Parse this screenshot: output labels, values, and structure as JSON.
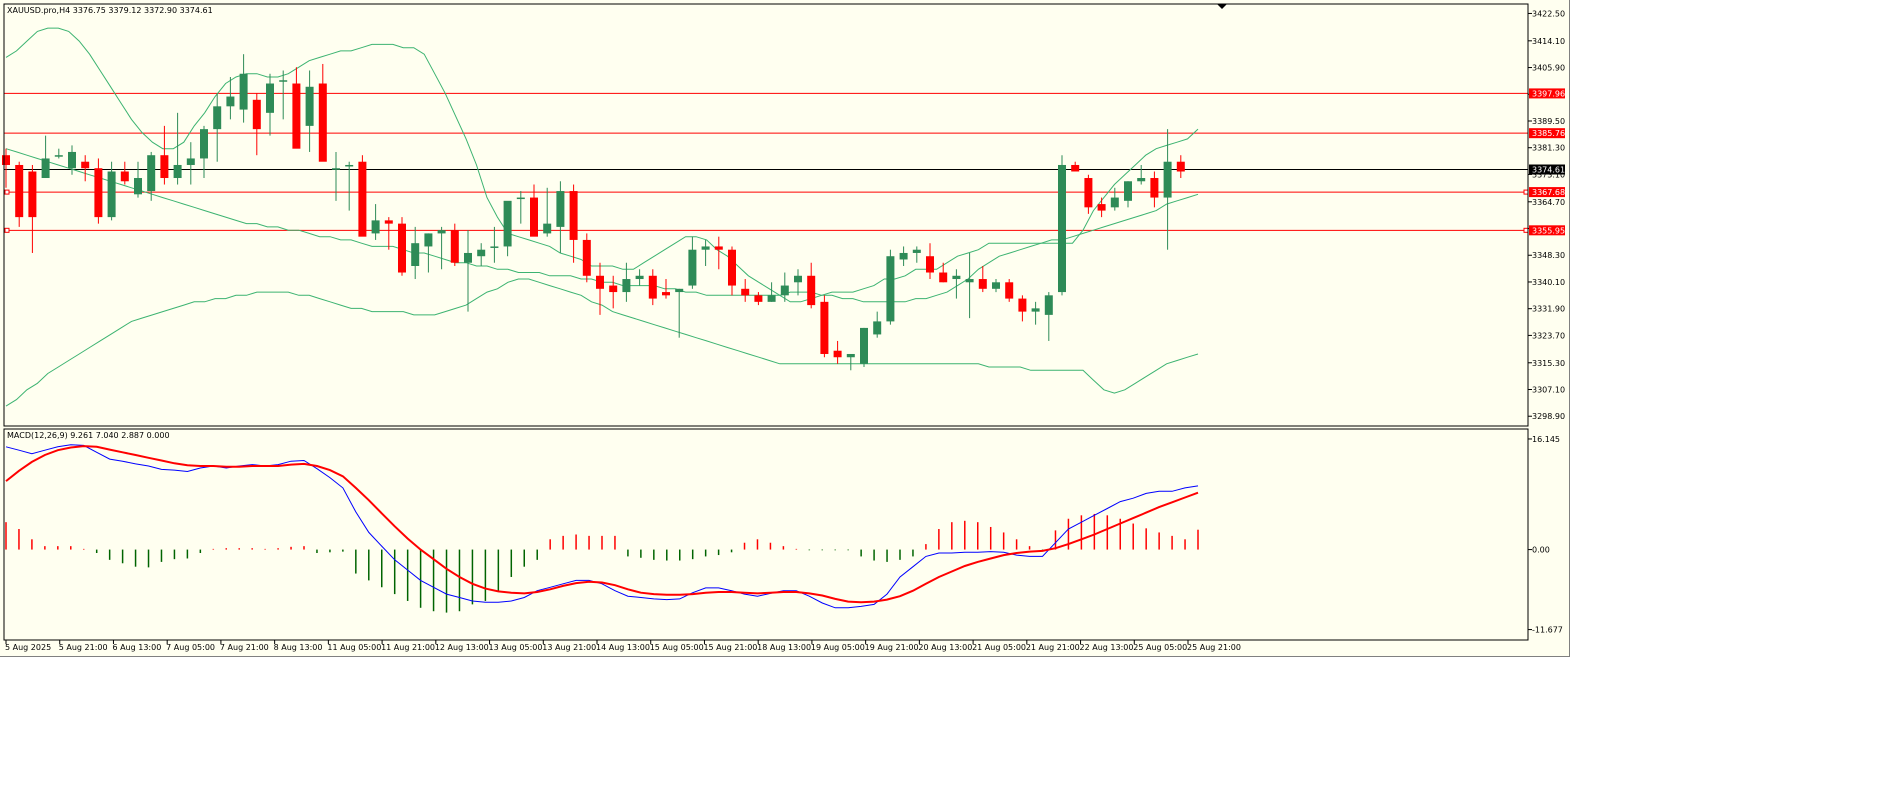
{
  "header": {
    "info": "XAUUSD.pro,H4  3376.75 3379.12 3372.90 3374.61"
  },
  "macd_panel": {
    "info": "MACD(12,26,9) 9.261 7.040 2.887 0.000"
  },
  "colors": {
    "background": "#fffff0",
    "bull": "#2e8b57",
    "bear": "#ff0000",
    "bollinger": "#3cb371",
    "hline": "#ff0000",
    "macd_line": "#0000ff",
    "signal_line": "#ff0000"
  },
  "chart_data": [
    {
      "type": "candlestick",
      "symbol": "XAUUSD.pro",
      "timeframe": "H4",
      "ohlc_header": {
        "open": 3376.75,
        "high": 3379.12,
        "low": 3372.9,
        "close": 3374.61
      },
      "ylim": [
        3295.9,
        3425.4
      ],
      "y_ticks": [
        3422.5,
        3414.1,
        3405.9,
        3397.7,
        3389.5,
        3381.3,
        3373.1,
        3364.7,
        3356.5,
        3348.3,
        3340.1,
        3331.9,
        3323.7,
        3315.3,
        3307.1,
        3298.9
      ],
      "price_levels": [
        {
          "label": "3397.96",
          "value": 3397.96
        },
        {
          "label": "3385.76",
          "value": 3385.76
        },
        {
          "label": "3367.68",
          "value": 3367.68
        },
        {
          "label": "3355.95",
          "value": 3355.95
        }
      ],
      "current_price": {
        "label": "3374.61",
        "value": 3374.61
      },
      "x_labels": [
        "5 Aug 2025",
        "5 Aug 21:00",
        "6 Aug 13:00",
        "7 Aug 05:00",
        "7 Aug 21:00",
        "8 Aug 13:00",
        "11 Aug 05:00",
        "11 Aug 21:00",
        "12 Aug 13:00",
        "13 Aug 05:00",
        "13 Aug 21:00",
        "14 Aug 13:00",
        "15 Aug 05:00",
        "15 Aug 21:00",
        "18 Aug 13:00",
        "19 Aug 05:00",
        "19 Aug 21:00",
        "20 Aug 13:00",
        "21 Aug 05:00",
        "21 Aug 21:00",
        "22 Aug 13:00",
        "25 Aug 05:00",
        "25 Aug 21:00"
      ],
      "candles": [
        [
          3379,
          3381,
          3369,
          3376
        ],
        [
          3376,
          3377,
          3357,
          3360
        ],
        [
          3374,
          3376,
          3349,
          3360
        ],
        [
          3372,
          3385,
          3372,
          3378
        ],
        [
          3379,
          3381,
          3378,
          3379
        ],
        [
          3375,
          3382,
          3373,
          3380
        ],
        [
          3377,
          3379,
          3371,
          3375
        ],
        [
          3375,
          3378,
          3358,
          3360
        ],
        [
          3360,
          3377,
          3359,
          3374
        ],
        [
          3374,
          3377,
          3370,
          3371
        ],
        [
          3367,
          3377,
          3366,
          3372
        ],
        [
          3368,
          3380,
          3365,
          3379
        ],
        [
          3379,
          3388,
          3370,
          3372
        ],
        [
          3372,
          3392,
          3370,
          3376
        ],
        [
          3376,
          3383,
          3370,
          3378
        ],
        [
          3378,
          3388,
          3372,
          3387
        ],
        [
          3387,
          3398,
          3377,
          3394
        ],
        [
          3394,
          3403,
          3390,
          3397
        ],
        [
          3393,
          3410,
          3389,
          3404
        ],
        [
          3396,
          3398,
          3379,
          3387
        ],
        [
          3392,
          3404,
          3385,
          3401
        ],
        [
          3402,
          3405,
          3390,
          3402
        ],
        [
          3401,
          3406,
          3386,
          3381
        ],
        [
          3388,
          3405,
          3380,
          3400
        ],
        [
          3401,
          3407,
          3385,
          3377
        ],
        [
          3375,
          3380,
          3365,
          3375
        ],
        [
          3376,
          3377,
          3362,
          3376
        ],
        [
          3377,
          3379,
          3358,
          3354
        ],
        [
          3355,
          3364,
          3353,
          3359
        ],
        [
          3359,
          3360,
          3350,
          3358
        ],
        [
          3358,
          3360,
          3342,
          3343
        ],
        [
          3345,
          3357,
          3341,
          3352
        ],
        [
          3351,
          3355,
          3343,
          3355
        ],
        [
          3355,
          3357,
          3344,
          3356
        ],
        [
          3356,
          3358,
          3345,
          3346
        ],
        [
          3346,
          3356,
          3331,
          3349
        ],
        [
          3348,
          3352,
          3345,
          3350
        ],
        [
          3351,
          3357,
          3346,
          3351
        ],
        [
          3351,
          3363,
          3348,
          3365
        ],
        [
          3366,
          3368,
          3358,
          3366
        ],
        [
          3366,
          3370,
          3356,
          3354
        ],
        [
          3355,
          3369,
          3354,
          3358
        ],
        [
          3357,
          3371,
          3349,
          3368
        ],
        [
          3368,
          3370,
          3346,
          3353
        ],
        [
          3353,
          3355,
          3340,
          3342
        ],
        [
          3342,
          3346,
          3330,
          3338
        ],
        [
          3339,
          3342,
          3332,
          3337
        ],
        [
          3337,
          3346,
          3334,
          3341
        ],
        [
          3341,
          3344,
          3339,
          3342
        ],
        [
          3342,
          3344,
          3333,
          3335
        ],
        [
          3337,
          3341,
          3335,
          3336
        ],
        [
          3337,
          3338,
          3323,
          3338
        ],
        [
          3339,
          3354,
          3338,
          3350
        ],
        [
          3350,
          3353,
          3345,
          3351
        ],
        [
          3351,
          3354,
          3344,
          3350
        ],
        [
          3350,
          3351,
          3336,
          3339
        ],
        [
          3338,
          3341,
          3334,
          3336
        ],
        [
          3336,
          3337,
          3333,
          3334
        ],
        [
          3334,
          3340,
          3334,
          3336
        ],
        [
          3336,
          3343,
          3334,
          3339
        ],
        [
          3340,
          3344,
          3336,
          3342
        ],
        [
          3342,
          3346,
          3332,
          3333
        ],
        [
          3334,
          3336,
          3317,
          3318
        ],
        [
          3319,
          3322,
          3315,
          3317
        ],
        [
          3317,
          3318,
          3313,
          3318
        ],
        [
          3315,
          3326,
          3314,
          3326
        ],
        [
          3324,
          3331,
          3323,
          3328
        ],
        [
          3328,
          3350,
          3327,
          3348
        ],
        [
          3347,
          3351,
          3345,
          3349
        ],
        [
          3349,
          3351,
          3346,
          3350
        ],
        [
          3348,
          3352,
          3341,
          3343
        ],
        [
          3343,
          3346,
          3340,
          3340
        ],
        [
          3341,
          3344,
          3335,
          3342
        ],
        [
          3340,
          3349,
          3329,
          3341
        ],
        [
          3341,
          3345,
          3337,
          3338
        ],
        [
          3338,
          3341,
          3337,
          3340
        ],
        [
          3340,
          3341,
          3334,
          3335
        ],
        [
          3335,
          3336,
          3328,
          3331
        ],
        [
          3331,
          3334,
          3327,
          3332
        ],
        [
          3330,
          3337,
          3322,
          3336
        ],
        [
          3337,
          3379,
          3336,
          3376
        ],
        [
          3376,
          3377,
          3374,
          3374
        ],
        [
          3372,
          3373,
          3361,
          3363
        ],
        [
          3364,
          3366,
          3360,
          3362
        ],
        [
          3363,
          3369,
          3362,
          3366
        ],
        [
          3365,
          3371,
          3363,
          3371
        ],
        [
          3371,
          3376,
          3370,
          3372
        ],
        [
          3372,
          3374,
          3363,
          3366
        ],
        [
          3366,
          3387,
          3350,
          3377
        ],
        [
          3377,
          3379,
          3372,
          3374
        ]
      ],
      "bollinger": {
        "upper": [
          3409,
          3411,
          3414,
          3417,
          3418,
          3418,
          3417,
          3414,
          3410,
          3405,
          3400,
          3395,
          3390,
          3386,
          3383,
          3381,
          3381,
          3383,
          3388,
          3392,
          3397,
          3401,
          3403,
          3404,
          3404,
          3403,
          3403,
          3404,
          3406,
          3408,
          3409,
          3410,
          3411,
          3411,
          3412,
          3413,
          3413,
          3413,
          3412,
          3412,
          3410,
          3404,
          3398,
          3391,
          3384,
          3376,
          3366,
          3360,
          3355,
          3354,
          3353,
          3352,
          3351,
          3349,
          3348,
          3347,
          3345,
          3345,
          3345,
          3344,
          3344,
          3346,
          3348,
          3350,
          3352,
          3354,
          3354,
          3353,
          3350,
          3348,
          3345,
          3342,
          3340,
          3338,
          3336,
          3334,
          3334,
          3335,
          3336,
          3337,
          3337,
          3337,
          3338,
          3339,
          3341,
          3341,
          3342,
          3344,
          3344,
          3344,
          3346,
          3348,
          3349,
          3350,
          3352,
          3352,
          3352,
          3352,
          3352,
          3352,
          3352,
          3352,
          3352,
          3356,
          3362,
          3366,
          3370,
          3373,
          3376,
          3379,
          3381,
          3382,
          3383,
          3384,
          3387
        ],
        "middle": [
          3381,
          3380,
          3379,
          3378,
          3377,
          3376,
          3375,
          3374,
          3373,
          3372,
          3371,
          3370,
          3369,
          3368,
          3367,
          3366,
          3365,
          3364,
          3363,
          3362,
          3361,
          3360,
          3359,
          3358,
          3358,
          3357,
          3357,
          3356,
          3356,
          3355,
          3354,
          3354,
          3353,
          3353,
          3352,
          3351,
          3351,
          3351,
          3350,
          3349,
          3349,
          3348,
          3347,
          3346,
          3346,
          3345,
          3345,
          3344,
          3344,
          3343,
          3343,
          3343,
          3342,
          3342,
          3342,
          3341,
          3341,
          3340,
          3340,
          3339,
          3339,
          3339,
          3339,
          3338,
          3338,
          3337,
          3337,
          3336,
          3336,
          3336,
          3336,
          3336,
          3336,
          3336,
          3336,
          3337,
          3337,
          3337,
          3336,
          3336,
          3335,
          3335,
          3334,
          3334,
          3334,
          3334,
          3334,
          3335,
          3335,
          3336,
          3337,
          3339,
          3341,
          3344,
          3346,
          3348,
          3349,
          3350,
          3351,
          3352,
          3353,
          3353,
          3354,
          3355,
          3356,
          3357,
          3358,
          3359,
          3360,
          3361,
          3362,
          3364,
          3365,
          3366,
          3367
        ],
        "lower": [
          3302,
          3304,
          3307,
          3309,
          3312,
          3314,
          3316,
          3318,
          3320,
          3322,
          3324,
          3326,
          3328,
          3329,
          3330,
          3331,
          3332,
          3333,
          3334,
          3334,
          3335,
          3335,
          3336,
          3336,
          3337,
          3337,
          3337,
          3337,
          3336,
          3336,
          3335,
          3334,
          3333,
          3332,
          3332,
          3331,
          3331,
          3331,
          3331,
          3330,
          3330,
          3330,
          3331,
          3332,
          3333,
          3335,
          3337,
          3338,
          3340,
          3341,
          3341,
          3340,
          3339,
          3338,
          3337,
          3336,
          3334,
          3333,
          3331,
          3330,
          3329,
          3328,
          3327,
          3326,
          3325,
          3324,
          3323,
          3322,
          3321,
          3320,
          3319,
          3318,
          3317,
          3316,
          3315,
          3315,
          3315,
          3315,
          3315,
          3315,
          3315,
          3315,
          3315,
          3315,
          3315,
          3315,
          3315,
          3315,
          3315,
          3315,
          3315,
          3315,
          3315,
          3315,
          3314,
          3314,
          3314,
          3314,
          3313,
          3313,
          3313,
          3313,
          3313,
          3313,
          3310,
          3307,
          3306,
          3307,
          3309,
          3311,
          3313,
          3315,
          3316,
          3317,
          3318
        ]
      }
    },
    {
      "type": "macd",
      "label": "MACD(12,26,9) 9.261 7.040 2.887 0.000",
      "ylim": [
        -13.2,
        17.6
      ],
      "y_ticks": [
        16.145,
        0.0,
        -11.677
      ],
      "macd": [
        15.0,
        14.5,
        14.0,
        14.5,
        15.0,
        15.3,
        15.2,
        14.2,
        13.2,
        12.9,
        12.5,
        12.2,
        11.7,
        11.6,
        11.4,
        11.9,
        12.2,
        11.9,
        12.2,
        12.4,
        12.2,
        12.4,
        12.9,
        13.0,
        11.8,
        10.5,
        9.0,
        5.5,
        2.5,
        0.5,
        -1.5,
        -3.0,
        -4.5,
        -5.5,
        -6.5,
        -7.0,
        -7.5,
        -7.7,
        -7.7,
        -7.5,
        -7.0,
        -6.0,
        -5.5,
        -5.0,
        -4.5,
        -4.5,
        -5.0,
        -6.0,
        -6.8,
        -7.0,
        -7.2,
        -7.3,
        -7.2,
        -6.3,
        -5.6,
        -5.6,
        -6.0,
        -6.5,
        -6.8,
        -6.4,
        -6.0,
        -6.0,
        -6.8,
        -7.8,
        -8.5,
        -8.5,
        -8.3,
        -8.0,
        -6.5,
        -4.0,
        -2.5,
        -1.0,
        -0.5,
        -0.5,
        -0.4,
        -0.4,
        -0.3,
        -0.4,
        -0.8,
        -1.0,
        -1.0,
        1.0,
        3.0,
        4.0,
        5.0,
        6.0,
        7.0,
        7.5,
        8.2,
        8.5,
        8.5,
        9.0,
        9.3
      ],
      "signal": [
        10.0,
        11.5,
        12.8,
        13.8,
        14.5,
        14.9,
        15.1,
        15.0,
        14.6,
        14.2,
        13.8,
        13.4,
        13.0,
        12.6,
        12.3,
        12.2,
        12.2,
        12.1,
        12.1,
        12.2,
        12.2,
        12.2,
        12.4,
        12.5,
        12.2,
        11.6,
        10.7,
        9.0,
        7.2,
        5.3,
        3.4,
        1.6,
        0.0,
        -1.4,
        -2.8,
        -4.0,
        -5.0,
        -5.7,
        -6.1,
        -6.3,
        -6.4,
        -6.2,
        -5.8,
        -5.3,
        -4.9,
        -4.7,
        -4.8,
        -5.2,
        -5.8,
        -6.3,
        -6.5,
        -6.6,
        -6.6,
        -6.5,
        -6.3,
        -6.2,
        -6.2,
        -6.3,
        -6.4,
        -6.3,
        -6.2,
        -6.2,
        -6.4,
        -6.7,
        -7.2,
        -7.6,
        -7.7,
        -7.6,
        -7.3,
        -6.8,
        -6.0,
        -5.0,
        -4.0,
        -3.2,
        -2.4,
        -1.8,
        -1.3,
        -0.8,
        -0.5,
        -0.3,
        -0.2,
        0.2,
        0.8,
        1.5,
        2.2,
        3.0,
        3.8,
        4.6,
        5.4,
        6.2,
        6.9,
        7.6,
        8.3
      ],
      "histogram": [
        4.0,
        3.0,
        1.5,
        0.5,
        0.5,
        0.5,
        0.1,
        -0.5,
        -1.5,
        -2.0,
        -2.5,
        -2.6,
        -1.8,
        -1.4,
        -1.3,
        -0.5,
        0.1,
        0.2,
        0.2,
        0.2,
        0.1,
        0.2,
        0.4,
        0.5,
        -0.5,
        -0.4,
        -0.3,
        -3.5,
        -4.5,
        -5.5,
        -6.5,
        -7.5,
        -8.5,
        -9.0,
        -9.2,
        -9.0,
        -8.0,
        -7.5,
        -6.0,
        -4.0,
        -2.5,
        -1.5,
        1.5,
        2.0,
        2.2,
        2.0,
        2.0,
        2.0,
        -1.0,
        -1.2,
        -1.5,
        -1.6,
        -1.6,
        -1.4,
        -1.0,
        -0.8,
        -0.4,
        1.0,
        1.5,
        1.0,
        0.5,
        0.1,
        -0.1,
        -0.1,
        -0.1,
        -0.1,
        -1.0,
        -1.6,
        -1.8,
        -1.5,
        -1.0,
        0.8,
        3.0,
        4.0,
        4.2,
        4.0,
        3.3,
        2.5,
        1.5,
        0.5,
        -0.2,
        2.8,
        4.5,
        5.0,
        5.2,
        5.0,
        4.5,
        3.8,
        3.1,
        2.5,
        2.0,
        1.5,
        2.9
      ]
    }
  ]
}
